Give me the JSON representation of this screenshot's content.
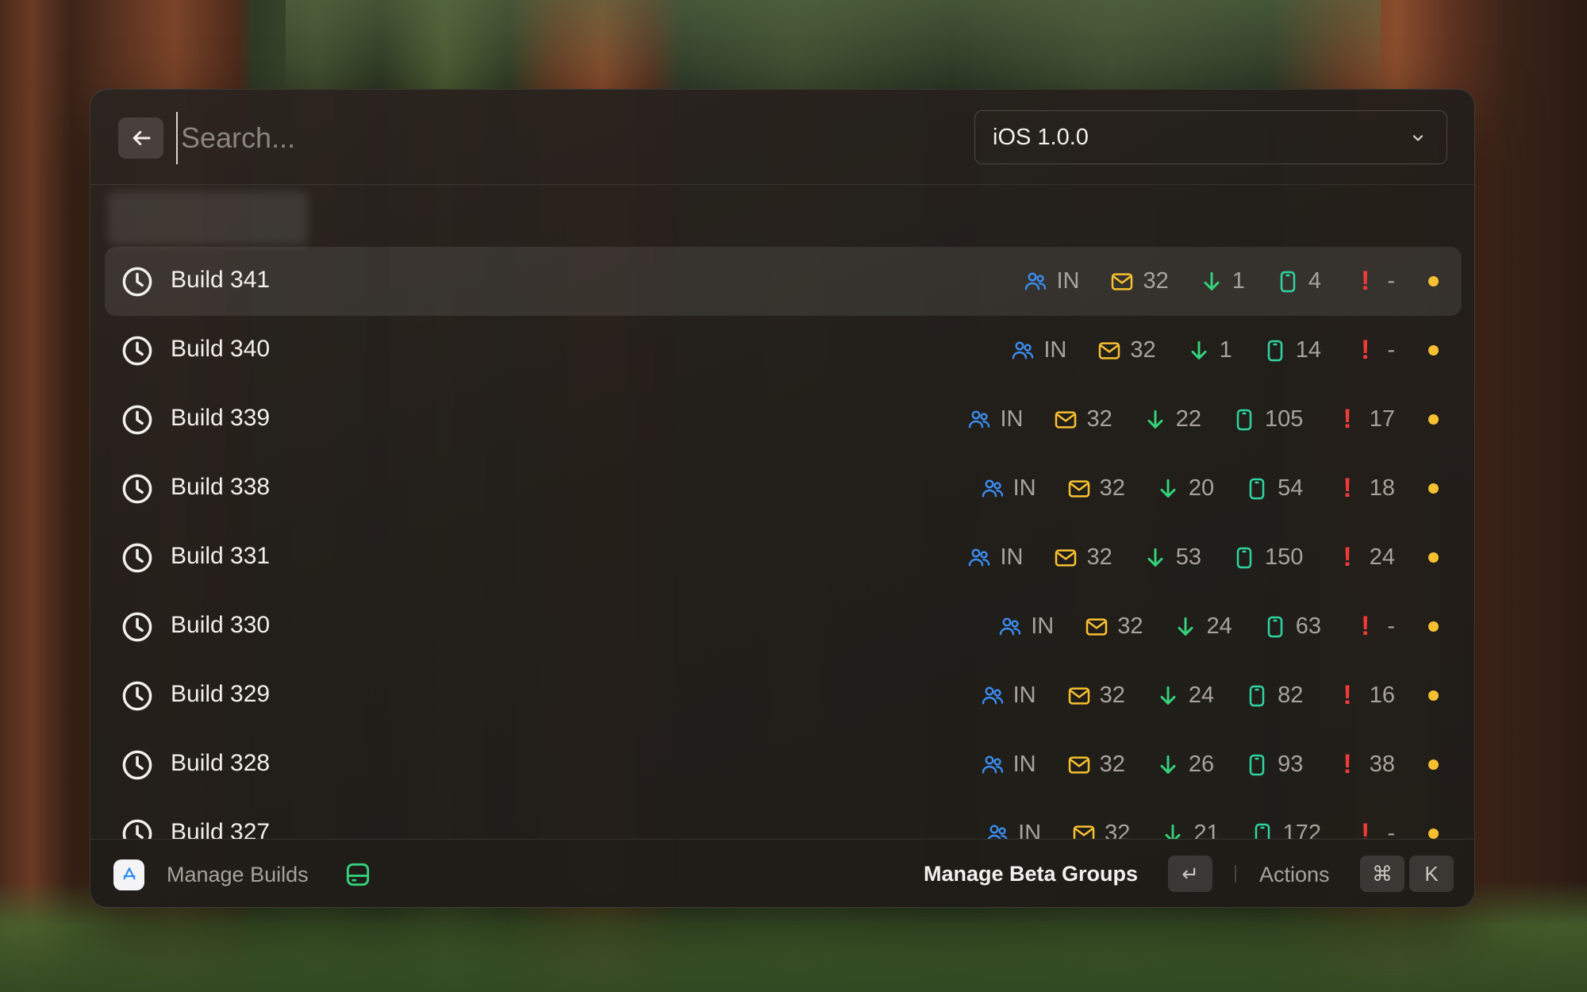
{
  "search": {
    "placeholder": "Search..."
  },
  "version_select": {
    "selected": "iOS 1.0.0"
  },
  "colors": {
    "group_blue": "#3b8cf0",
    "mail_yellow": "#f6c030",
    "download_green": "#34d27a",
    "device_green": "#2fd3a0",
    "alert_red": "#ef3b3b",
    "status_dot": "#f6c030"
  },
  "builds": [
    {
      "title": "Build 341",
      "group": "IN",
      "invites": "32",
      "installs": "1",
      "sessions": "4",
      "crashes": "-",
      "selected": true
    },
    {
      "title": "Build 340",
      "group": "IN",
      "invites": "32",
      "installs": "1",
      "sessions": "14",
      "crashes": "-"
    },
    {
      "title": "Build 339",
      "group": "IN",
      "invites": "32",
      "installs": "22",
      "sessions": "105",
      "crashes": "17"
    },
    {
      "title": "Build 338",
      "group": "IN",
      "invites": "32",
      "installs": "20",
      "sessions": "54",
      "crashes": "18"
    },
    {
      "title": "Build 331",
      "group": "IN",
      "invites": "32",
      "installs": "53",
      "sessions": "150",
      "crashes": "24"
    },
    {
      "title": "Build 330",
      "group": "IN",
      "invites": "32",
      "installs": "24",
      "sessions": "63",
      "crashes": "-"
    },
    {
      "title": "Build 329",
      "group": "IN",
      "invites": "32",
      "installs": "24",
      "sessions": "82",
      "crashes": "16"
    },
    {
      "title": "Build 328",
      "group": "IN",
      "invites": "32",
      "installs": "26",
      "sessions": "93",
      "crashes": "38"
    },
    {
      "title": "Build 327",
      "group": "IN",
      "invites": "32",
      "installs": "21",
      "sessions": "172",
      "crashes": "-"
    }
  ],
  "footer": {
    "title": "Manage Builds",
    "primary_action": "Manage Beta Groups",
    "primary_shortcut": "↵",
    "actions_label": "Actions",
    "actions_shortcut_mod": "⌘",
    "actions_shortcut_key": "K"
  }
}
